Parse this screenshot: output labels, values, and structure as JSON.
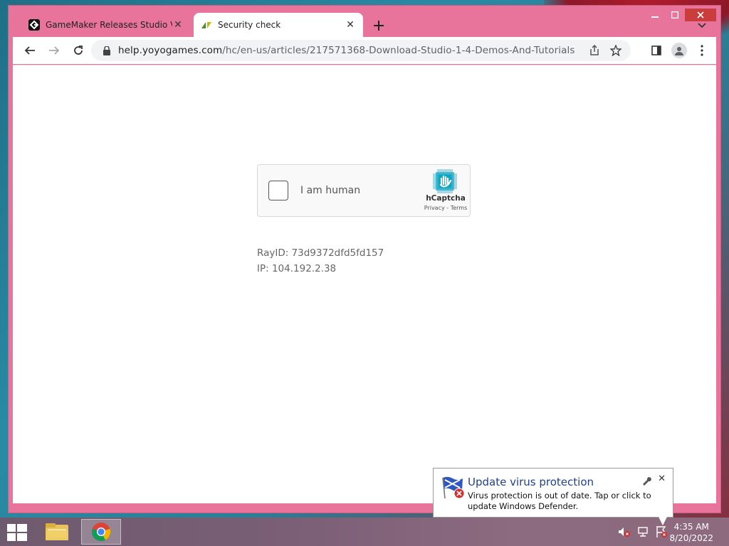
{
  "browser": {
    "tabs": [
      {
        "title": "GameMaker Releases Studio Vers",
        "icon": "gamemaker-icon",
        "active": false
      },
      {
        "title": "Security check",
        "icon": "zendesk-icon",
        "active": true
      }
    ],
    "url_host": "help.yoyogames.com",
    "url_path": "/hc/en-us/articles/217571368-Download-Studio-1-4-Demos-And-Tutorials"
  },
  "captcha": {
    "label": "I am human",
    "brand": "hCaptcha",
    "links": "Privacy - Terms"
  },
  "page": {
    "ray_id": "RayID: 73d9372dfd5fd157",
    "ip": "IP: 104.192.2.38"
  },
  "notification": {
    "title": "Update virus protection",
    "body": "Virus protection is out of date. Tap or click to update Windows Defender."
  },
  "taskbar": {
    "time": "4:35 AM",
    "date": "8/20/2022"
  },
  "colors": {
    "window_frame": "#e8739b",
    "close_button": "#c93d3d",
    "balloon_title": "#1e3f9a"
  }
}
